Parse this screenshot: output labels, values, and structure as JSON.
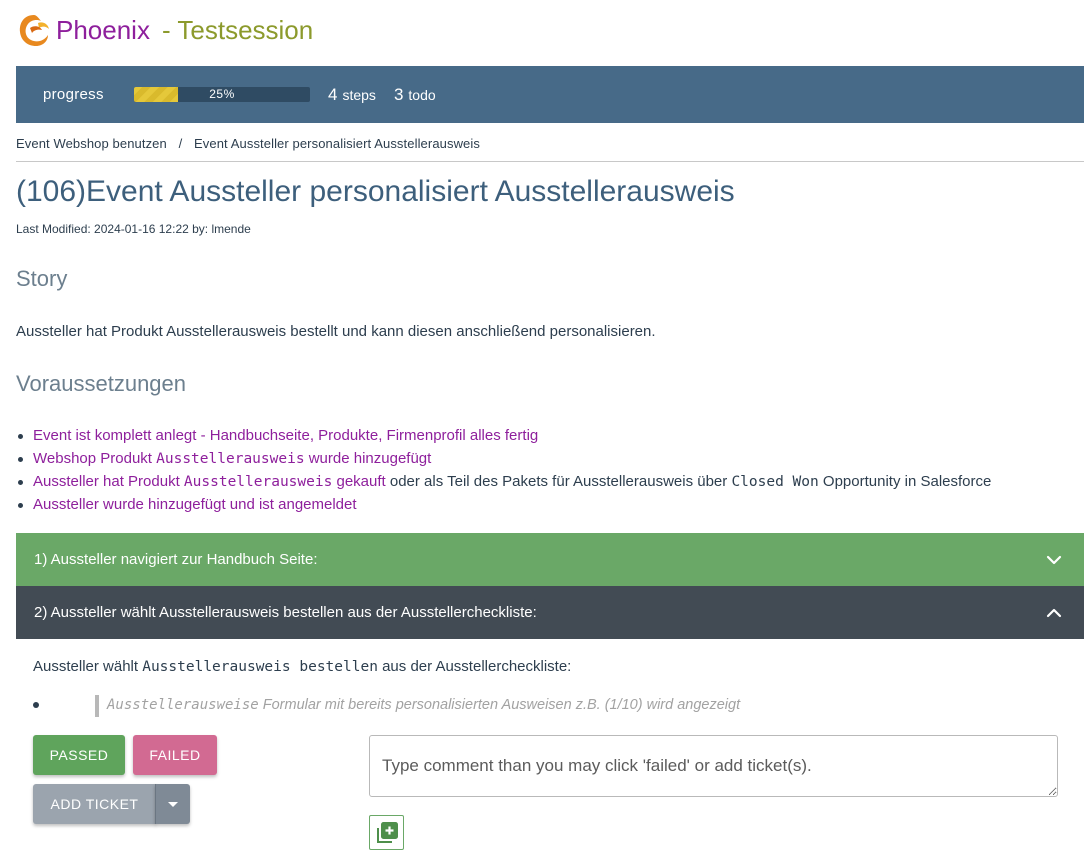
{
  "app": {
    "brand": "Phoenix",
    "session": "- Testsession",
    "logo_icon": "phoenix-bird-icon"
  },
  "progress": {
    "label": "progress",
    "percent": 25,
    "percent_text": "25%",
    "steps_count": "4",
    "steps_word": "steps",
    "todo_count": "3",
    "todo_word": "todo"
  },
  "breadcrumb": {
    "items": [
      "Event Webshop benutzen",
      "Event Aussteller personalisiert Ausstellerausweis"
    ],
    "separator": "/"
  },
  "page": {
    "title": "(106)Event Aussteller personalisiert Ausstellerausweis",
    "last_modified": "Last Modified: 2024-01-16 12:22 by: lmende"
  },
  "story": {
    "heading": "Story",
    "text": "Aussteller hat Produkt Ausstellerausweis bestellt und kann diesen anschließend personalisieren."
  },
  "preconditions": {
    "heading": "Voraussetzungen",
    "items": [
      {
        "text": "Event ist komplett anlegt - Handbuchseite, Produkte, Firmenprofil alles fertig"
      },
      {
        "pre": "Webshop Produkt ",
        "code": "Ausstellerausweis",
        "post": " wurde hinzugefügt"
      },
      {
        "pre": "Aussteller hat Produkt ",
        "code": "Ausstellerausweis",
        "post": " gekauft",
        "rest_pre": " oder als Teil des Pakets für Ausstellerausweis über ",
        "rest_code": "Closed Won",
        "rest_post": " Opportunity in Salesforce"
      },
      {
        "text": "Aussteller wurde hinzugefügt und ist angemeldet"
      }
    ]
  },
  "steps": [
    {
      "label": "1) Aussteller navigiert zur Handbuch Seite:",
      "state": "passed",
      "expanded": false,
      "icon": "chevron-down-icon"
    },
    {
      "label": "2) Aussteller wählt Ausstellerausweis bestellen aus der Ausstellercheckliste:",
      "state": "active",
      "expanded": true,
      "icon": "chevron-up-icon"
    }
  ],
  "step_detail": {
    "text_pre": "Aussteller wählt ",
    "text_code": "Ausstellerausweis bestellen",
    "text_post": " aus der Ausstellercheckliste:",
    "expected_code": "Ausstellerausweise",
    "expected_text": " Formular mit bereits personalisierten Ausweisen z.B. (1/10) wird angezeigt"
  },
  "actions": {
    "passed_label": "PASSED",
    "failed_label": "FAILED",
    "add_ticket_label": "ADD TICKET",
    "comment_placeholder": "Type comment than you may click 'failed' or add ticket(s).",
    "add_icon": "add-box-icon"
  },
  "colors": {
    "brand": "#8e1f9c",
    "session": "#8c9a2c",
    "progress_bg": "#476a88",
    "progress_fill": "#e5c83a",
    "step_passed": "#6aa867",
    "step_active": "#424b54",
    "passed_button": "#5fa45c",
    "failed_button": "#d26a92",
    "ticket_button": "#9ba4ae",
    "link_magenta": "#8e1f9c",
    "title": "#3d5f7c"
  }
}
